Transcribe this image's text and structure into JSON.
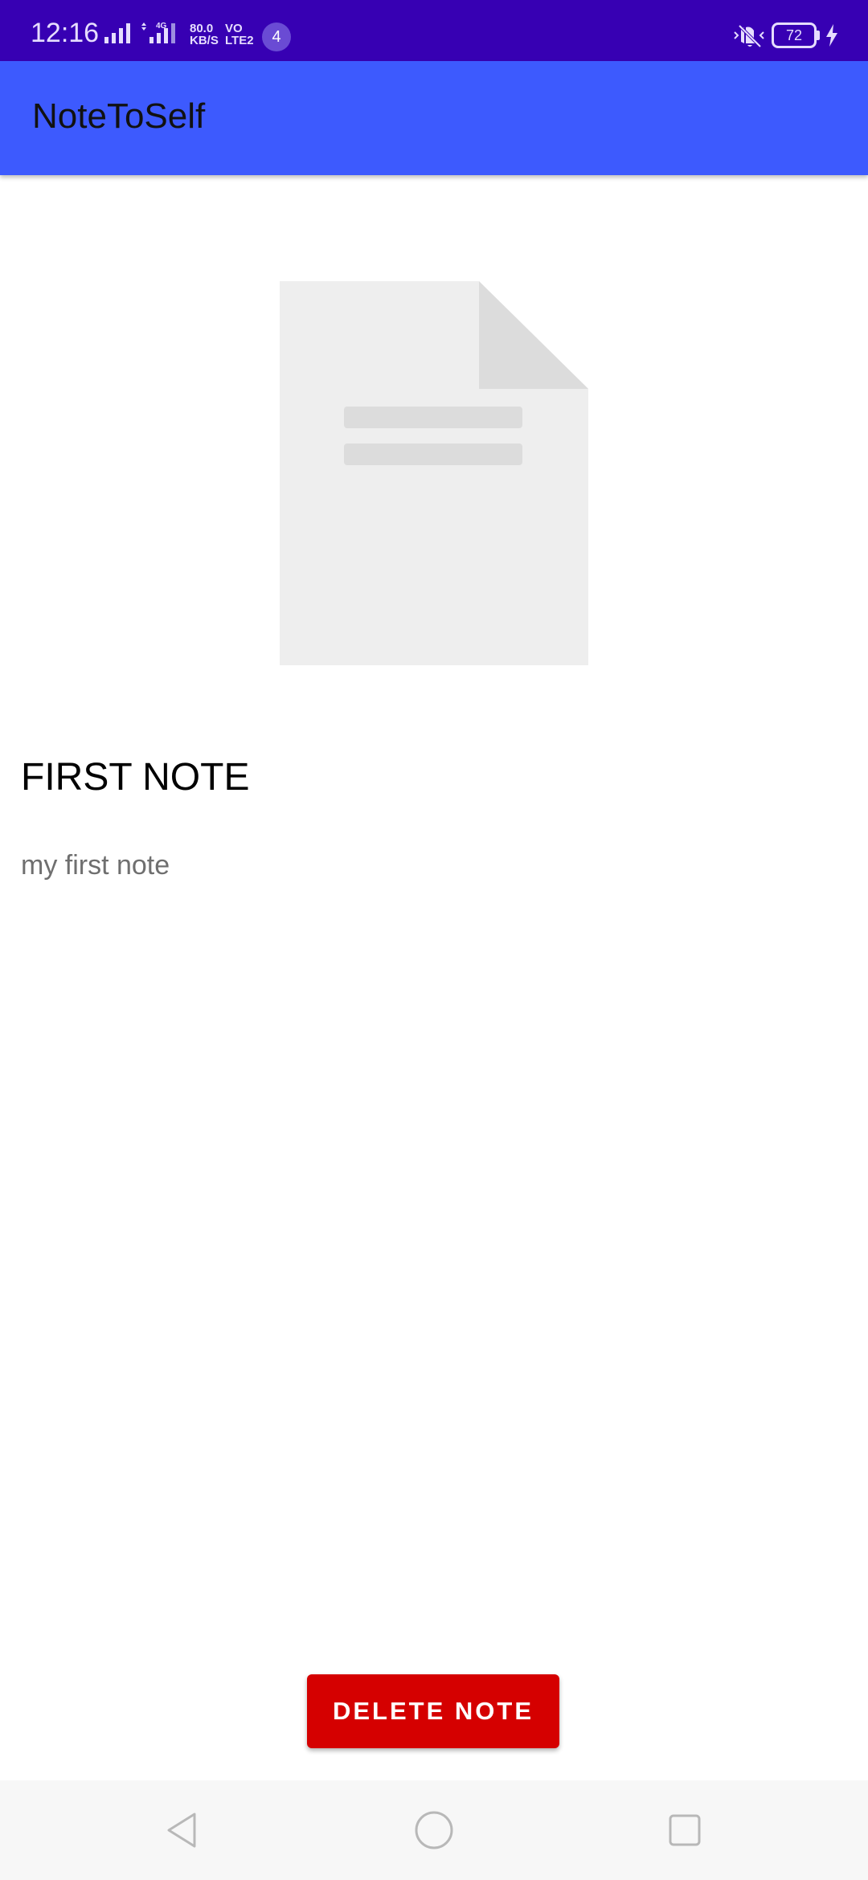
{
  "status_bar": {
    "time": "12:16",
    "network_type": "4G",
    "net_speed_value": "80.0",
    "net_speed_unit": "KB/S",
    "volte_top": "VO",
    "volte_bottom": "LTE2",
    "notification_count": "4",
    "battery_level": "72",
    "icons": [
      "signal-icon",
      "signal-4g-icon",
      "mute-icon",
      "battery-icon",
      "charging-icon"
    ]
  },
  "app_bar": {
    "title": "NoteToSelf"
  },
  "note": {
    "image_icon": "document-placeholder-icon",
    "title": "FIRST NOTE",
    "body": "my first note"
  },
  "actions": {
    "delete_label": "DELETE NOTE"
  },
  "nav_bar": {
    "icons": [
      "back-icon",
      "home-icon",
      "recents-icon"
    ]
  },
  "colors": {
    "status_bar": "#3700b3",
    "app_bar": "#3d5afe",
    "delete_button": "#d50000",
    "placeholder_light": "#eeeeee",
    "placeholder_dark": "#dcdcdc"
  }
}
